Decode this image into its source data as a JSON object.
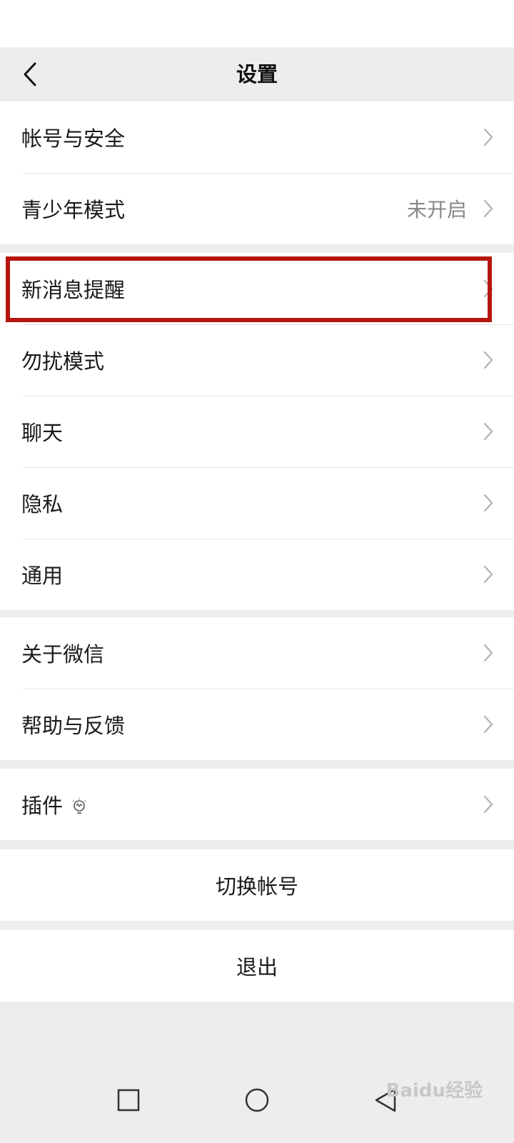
{
  "header": {
    "title": "设置",
    "back_icon": "chevron-left-icon"
  },
  "groups": [
    {
      "items": [
        {
          "label": "帐号与安全",
          "value": ""
        },
        {
          "label": "青少年模式",
          "value": "未开启"
        }
      ]
    },
    {
      "items": [
        {
          "label": "新消息提醒",
          "value": "",
          "highlighted": true
        },
        {
          "label": "勿扰模式",
          "value": ""
        },
        {
          "label": "聊天",
          "value": ""
        },
        {
          "label": "隐私",
          "value": ""
        },
        {
          "label": "通用",
          "value": ""
        }
      ]
    },
    {
      "items": [
        {
          "label": "关于微信",
          "value": ""
        },
        {
          "label": "帮助与反馈",
          "value": ""
        }
      ]
    },
    {
      "items": [
        {
          "label": "插件",
          "value": "",
          "icon": "lightbulb-icon"
        }
      ]
    }
  ],
  "actions": {
    "switch_account": "切换帐号",
    "logout": "退出"
  },
  "system_nav": {
    "recents_icon": "square-icon",
    "home_icon": "circle-icon",
    "back_icon": "triangle-back-icon"
  },
  "watermark": "Baidu经验",
  "colors": {
    "background": "#ededed",
    "card": "#ffffff",
    "highlight": "#b5160f",
    "secondary_text": "#888888"
  }
}
